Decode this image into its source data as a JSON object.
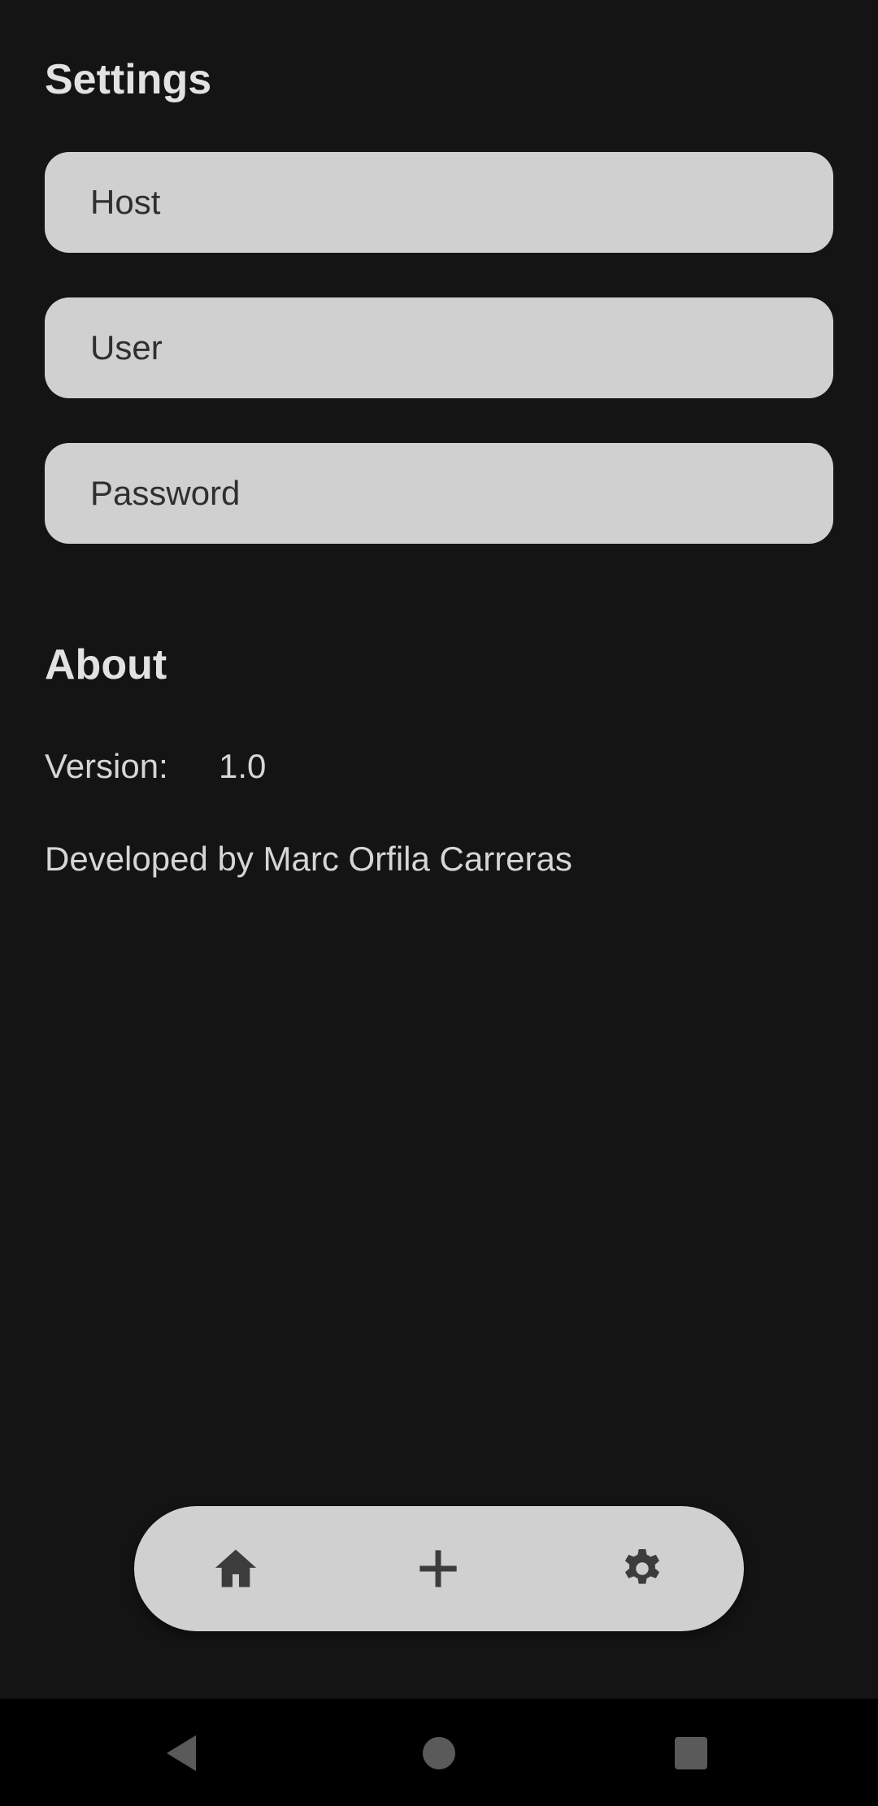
{
  "settings": {
    "title": "Settings",
    "fields": {
      "host": {
        "placeholder": "Host",
        "value": ""
      },
      "user": {
        "placeholder": "User",
        "value": ""
      },
      "password": {
        "placeholder": "Password",
        "value": ""
      }
    }
  },
  "about": {
    "title": "About",
    "version_label": "Version:",
    "version_value": "1.0",
    "developer": "Developed by Marc Orfila Carreras"
  },
  "bottom_nav": {
    "items": [
      {
        "icon": "home-icon"
      },
      {
        "icon": "add-icon"
      },
      {
        "icon": "gear-icon"
      }
    ],
    "icon_color": "#3c3c3c",
    "background": "#d0d0d0"
  },
  "system_nav": {
    "items": [
      {
        "icon": "back-icon"
      },
      {
        "icon": "home-circle-icon"
      },
      {
        "icon": "recents-icon"
      }
    ],
    "icon_color": "#5a5a5a"
  },
  "colors": {
    "app_background": "#141414",
    "field_background": "#d0d0d0",
    "text_primary": "#e2e2e2"
  }
}
